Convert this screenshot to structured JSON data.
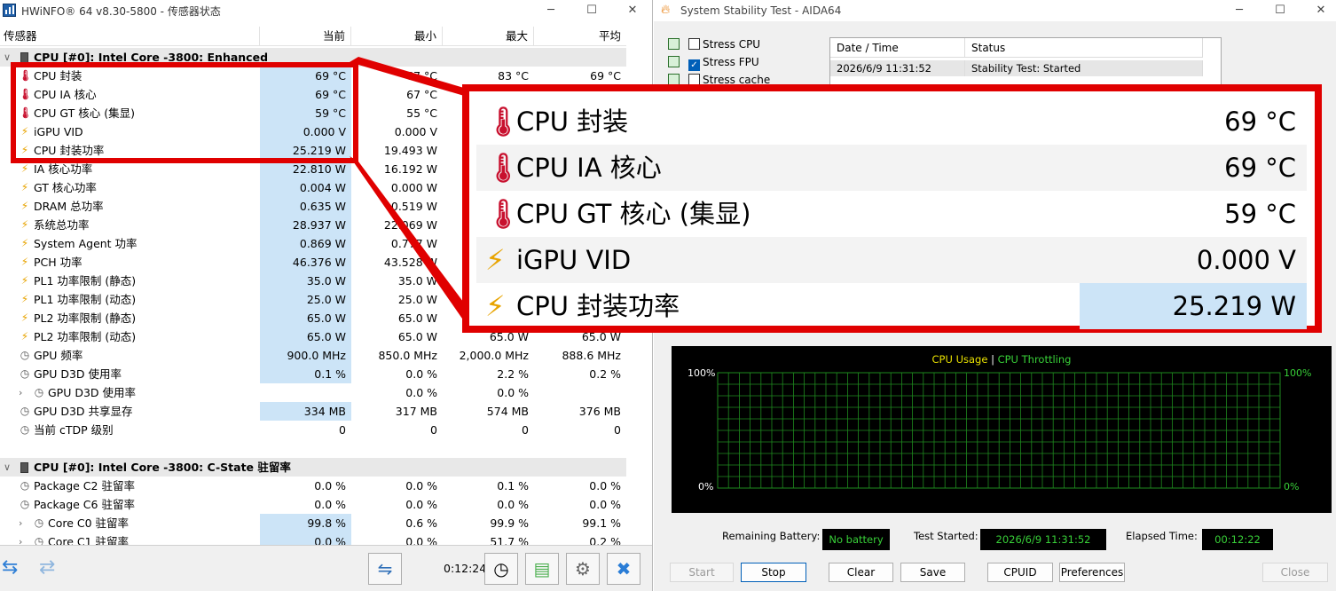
{
  "hwinfo": {
    "title": "HWiNFO® 64 v8.30-5800 - 传感器状态",
    "columns": {
      "sensor": "传感器",
      "current": "当前",
      "min": "最小",
      "max": "最大",
      "avg": "平均"
    },
    "group1": "CPU [#0]: Intel Core -3800: Enhanced",
    "rows1": [
      {
        "icon": "thermometer-icon",
        "label": "CPU 封装",
        "cur": "69 °C",
        "min": "67 °C",
        "max": "83 °C",
        "avg": "69 °C"
      },
      {
        "icon": "thermometer-icon",
        "label": "CPU IA 核心",
        "cur": "69 °C",
        "min": "67 °C",
        "max": "",
        "avg": ""
      },
      {
        "icon": "thermometer-icon",
        "label": "CPU GT 核心 (集显)",
        "cur": "59 °C",
        "min": "55 °C",
        "max": "",
        "avg": ""
      },
      {
        "icon": "lightning-icon",
        "label": "iGPU VID",
        "cur": "0.000 V",
        "min": "0.000 V",
        "max": "",
        "avg": ""
      },
      {
        "icon": "lightning-icon",
        "label": "CPU 封装功率",
        "cur": "25.219 W",
        "min": "19.493 W",
        "max": "",
        "avg": ""
      },
      {
        "icon": "lightning-icon",
        "label": "IA 核心功率",
        "cur": "22.810 W",
        "min": "16.192 W",
        "max": "",
        "avg": ""
      },
      {
        "icon": "lightning-icon",
        "label": "GT 核心功率",
        "cur": "0.004 W",
        "min": "0.000 W",
        "max": "",
        "avg": ""
      },
      {
        "icon": "lightning-icon",
        "label": "DRAM 总功率",
        "cur": "0.635 W",
        "min": "0.519 W",
        "max": "",
        "avg": ""
      },
      {
        "icon": "lightning-icon",
        "label": "系统总功率",
        "cur": "28.937 W",
        "min": "22.069 W",
        "max": "",
        "avg": ""
      },
      {
        "icon": "lightning-icon",
        "label": "System Agent 功率",
        "cur": "0.869 W",
        "min": "0.777 W",
        "max": "",
        "avg": ""
      },
      {
        "icon": "lightning-icon",
        "label": "PCH 功率",
        "cur": "46.376 W",
        "min": "43.528 W",
        "max": "",
        "avg": ""
      },
      {
        "icon": "lightning-icon",
        "label": "PL1 功率限制 (静态)",
        "cur": "35.0 W",
        "min": "35.0 W",
        "max": "",
        "avg": ""
      },
      {
        "icon": "lightning-icon",
        "label": "PL1 功率限制 (动态)",
        "cur": "25.0 W",
        "min": "25.0 W",
        "max": "",
        "avg": ""
      },
      {
        "icon": "lightning-icon",
        "label": "PL2 功率限制 (静态)",
        "cur": "65.0 W",
        "min": "65.0 W",
        "max": "",
        "avg": ""
      },
      {
        "icon": "lightning-icon",
        "label": "PL2 功率限制 (动态)",
        "cur": "65.0 W",
        "min": "65.0 W",
        "max": "65.0 W",
        "avg": "65.0 W"
      },
      {
        "icon": "clock-icon",
        "label": "GPU 频率",
        "cur": "900.0 MHz",
        "min": "850.0 MHz",
        "max": "2,000.0 MHz",
        "avg": "888.6 MHz"
      },
      {
        "icon": "clock-icon",
        "label": "GPU D3D 使用率",
        "cur": "0.1 %",
        "min": "0.0 %",
        "max": "2.2 %",
        "avg": "0.2 %"
      },
      {
        "icon": "clock-icon",
        "label": "GPU D3D 使用率",
        "cur": "",
        "min": "0.0 %",
        "max": "0.0 %",
        "avg": "",
        "expand": true
      },
      {
        "icon": "clock-icon",
        "label": "GPU D3D 共享显存",
        "cur": "334 MB",
        "min": "317 MB",
        "max": "574 MB",
        "avg": "376 MB"
      },
      {
        "icon": "clock-icon",
        "label": "当前 cTDP 级别",
        "cur": "0",
        "min": "0",
        "max": "0",
        "avg": "0",
        "nohl": true
      }
    ],
    "group2": "CPU [#0]: Intel Core -3800: C-State 驻留率",
    "rows2": [
      {
        "icon": "clock-icon",
        "label": "Package C2 驻留率",
        "cur": "0.0 %",
        "min": "0.0 %",
        "max": "0.1 %",
        "avg": "0.0 %",
        "nohl": true
      },
      {
        "icon": "clock-icon",
        "label": "Package C6 驻留率",
        "cur": "0.0 %",
        "min": "0.0 %",
        "max": "0.0 %",
        "avg": "0.0 %",
        "nohl": true
      },
      {
        "icon": "clock-icon",
        "label": "Core C0 驻留率",
        "cur": "99.8 %",
        "min": "0.6 %",
        "max": "99.9 %",
        "avg": "99.1 %",
        "expand": true
      },
      {
        "icon": "clock-icon",
        "label": "Core C1 驻留率",
        "cur": "0.0 %",
        "min": "0.0 %",
        "max": "51.7 %",
        "avg": "0.2 %",
        "expand": true
      }
    ],
    "timer": "0:12:24"
  },
  "aida": {
    "title": "System Stability Test - AIDA64",
    "stress": [
      {
        "label": "Stress CPU",
        "checked": false
      },
      {
        "label": "Stress FPU",
        "checked": true
      },
      {
        "label": "Stress cache",
        "checked": false
      }
    ],
    "log_headers": {
      "datetime": "Date / Time",
      "status": "Status"
    },
    "log_row": {
      "datetime": "2026/6/9 11:31:52",
      "status": "Stability Test: Started"
    },
    "graph": {
      "legend_usage": "CPU Usage",
      "legend_sep": "|",
      "legend_throttling": "CPU Throttling",
      "y_top_left": "100%",
      "y_bottom_left": "0%",
      "y_top_right": "100%",
      "y_bottom_right": "0%",
      "grid_color": "#1f8a1f",
      "usage_color": "#e8e000",
      "throttle_color": "#38d038"
    },
    "info": {
      "battery_label": "Remaining Battery:",
      "battery_value": "No battery",
      "started_label": "Test Started:",
      "started_value": "2026/6/9 11:31:52",
      "elapsed_label": "Elapsed Time:",
      "elapsed_value": "00:12:22"
    },
    "buttons": {
      "start": "Start",
      "stop": "Stop",
      "clear": "Clear",
      "save": "Save",
      "cpuid": "CPUID",
      "preferences": "Preferences",
      "close": "Close"
    }
  },
  "zoom": {
    "rows": [
      {
        "icon": "thermometer-icon",
        "label": "CPU 封装",
        "value": "69 °C"
      },
      {
        "icon": "thermometer-icon",
        "label": "CPU IA 核心",
        "value": "69 °C"
      },
      {
        "icon": "thermometer-icon",
        "label": "CPU GT 核心 (集显)",
        "value": "59 °C"
      },
      {
        "icon": "lightning-icon",
        "label": "iGPU VID",
        "value": "0.000 V"
      },
      {
        "icon": "lightning-icon",
        "label": "CPU 封装功率",
        "value": "25.219 W",
        "highlight": true
      }
    ],
    "color": "#e00000"
  }
}
